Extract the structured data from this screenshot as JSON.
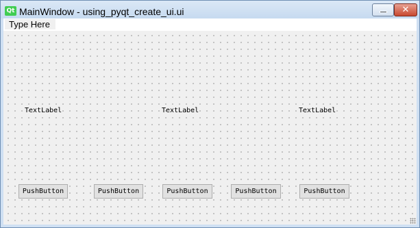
{
  "window": {
    "app_icon_text": "Qt",
    "title": "MainWindow - using_pyqt_create_ui.ui",
    "minimize_glyph": "minimize-icon",
    "close_glyph": "✕"
  },
  "menubar": {
    "items": [
      {
        "label": "Type Here"
      }
    ]
  },
  "form": {
    "labels": [
      {
        "text": "TextLabel"
      },
      {
        "text": "TextLabel"
      },
      {
        "text": "TextLabel"
      }
    ],
    "buttons": [
      {
        "label": "PushButton"
      },
      {
        "label": "PushButton"
      },
      {
        "label": "PushButton"
      },
      {
        "label": "PushButton"
      },
      {
        "label": "PushButton"
      }
    ]
  },
  "colors": {
    "titlebar": "#c6daf0",
    "canvas": "#f0f0f0",
    "close_button": "#c8482f",
    "qt_green": "#41cd52"
  }
}
